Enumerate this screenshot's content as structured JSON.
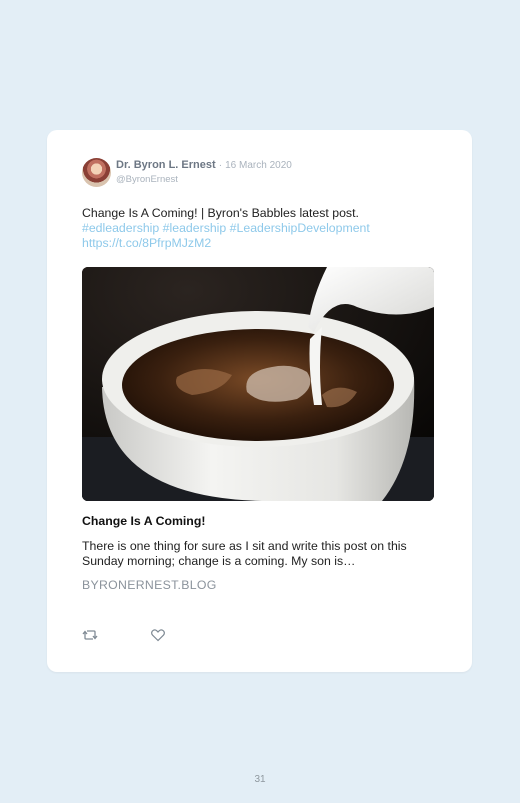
{
  "tweet": {
    "author": "Dr. Byron L. Ernest",
    "separator": "·",
    "date": "16 March 2020",
    "handle": "@ByronErnest",
    "text_line1": "Change Is A Coming! | Byron's Babbles latest post.",
    "hashtags": "#edleadership #leadership #LeadershipDevelopment",
    "link": "https://t.co/8PfrpMJzM2"
  },
  "preview": {
    "title": "Change Is A Coming!",
    "description": "There is one thing for sure as I sit and write this post on this Sunday morning; change is a coming. My son is…",
    "domain": "BYRONERNEST.BLOG"
  },
  "actions": {
    "retweet_icon": "retweet-icon",
    "like_icon": "heart-icon"
  },
  "page": {
    "number": "31"
  },
  "colors": {
    "background": "#e3eef6",
    "card": "#ffffff",
    "link": "#8ec9ea",
    "author": "#6d7784",
    "muted": "#aab3bd"
  }
}
